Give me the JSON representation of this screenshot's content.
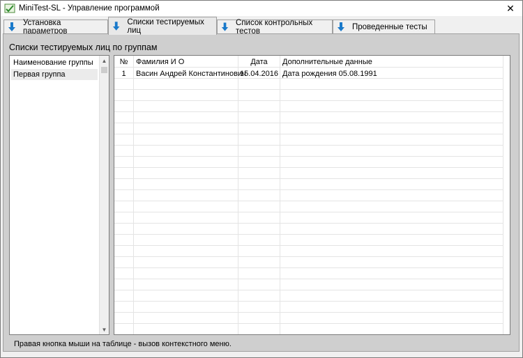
{
  "window": {
    "title": "MiniTest-SL - Управление программой",
    "close_glyph": "✕"
  },
  "tabs": [
    {
      "label": "Установка параметров",
      "icon": "arrow-down-icon",
      "active": false
    },
    {
      "label": "Списки тестируемых лиц",
      "icon": "arrow-down-icon",
      "active": true
    },
    {
      "label": "Список контрольных тестов",
      "icon": "arrow-down-icon",
      "active": false
    },
    {
      "label": "Проведенные тесты",
      "icon": "arrow-down-icon",
      "active": false
    }
  ],
  "panel": {
    "title": "Списки тестируемых лиц по группам"
  },
  "groups": {
    "header": "Наименование группы",
    "items": [
      "Первая группа"
    ],
    "scroll_up_glyph": "▲",
    "scroll_down_glyph": "▼"
  },
  "table": {
    "columns": [
      "№",
      "Фамилия И О",
      "Дата",
      "Дополнительные данные"
    ],
    "rows": [
      [
        "1",
        "Васин Андрей Константинович",
        "15.04.2016",
        "Дата рождения 05.08.1991"
      ]
    ]
  },
  "status": {
    "text": "Правая кнопка мыши на таблице - вызов контекстного меню."
  },
  "colors": {
    "accent": "#1979ca",
    "panel_bg": "#cfcfcf",
    "grid_line": "#e4e4e4"
  }
}
